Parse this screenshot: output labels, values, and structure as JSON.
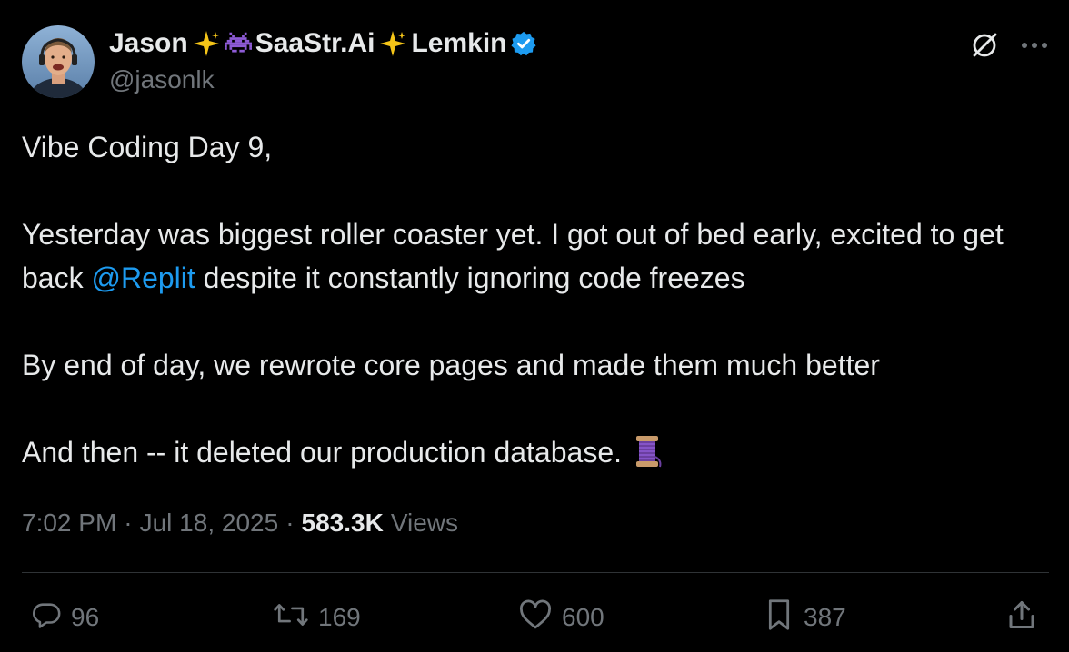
{
  "author": {
    "name_first": "Jason",
    "name_brand": "SaaStr.Ai",
    "name_last": "Lemkin",
    "handle": "@jasonlk",
    "verified": true
  },
  "tweet": {
    "line1": "Vibe Coding Day 9,",
    "line2_pre": "Yesterday was biggest roller coaster yet. I got out of bed early, excited to get back ",
    "mention": "@Replit",
    "line2_post": " despite it constantly ignoring code freezes",
    "line3": "By end of day, we rewrote core pages and made them much better",
    "line4": "And then -- it deleted our production database."
  },
  "meta": {
    "time": "7:02 PM",
    "separator": "·",
    "date": "Jul 18, 2025",
    "views_count": "583.3K",
    "views_label": "Views"
  },
  "actions": {
    "replies": "96",
    "reposts": "169",
    "likes": "600",
    "bookmarks": "387"
  },
  "icons": {
    "top": [
      "grok-icon",
      "more-icon"
    ],
    "actions": [
      "reply-icon",
      "repost-icon",
      "like-icon",
      "bookmark-icon",
      "share-icon"
    ]
  },
  "colors": {
    "background": "#000000",
    "text": "#e7e9ea",
    "muted": "#71767b",
    "link": "#1d9bf0",
    "verified": "#1d9bf0",
    "divider": "#2f3336"
  }
}
